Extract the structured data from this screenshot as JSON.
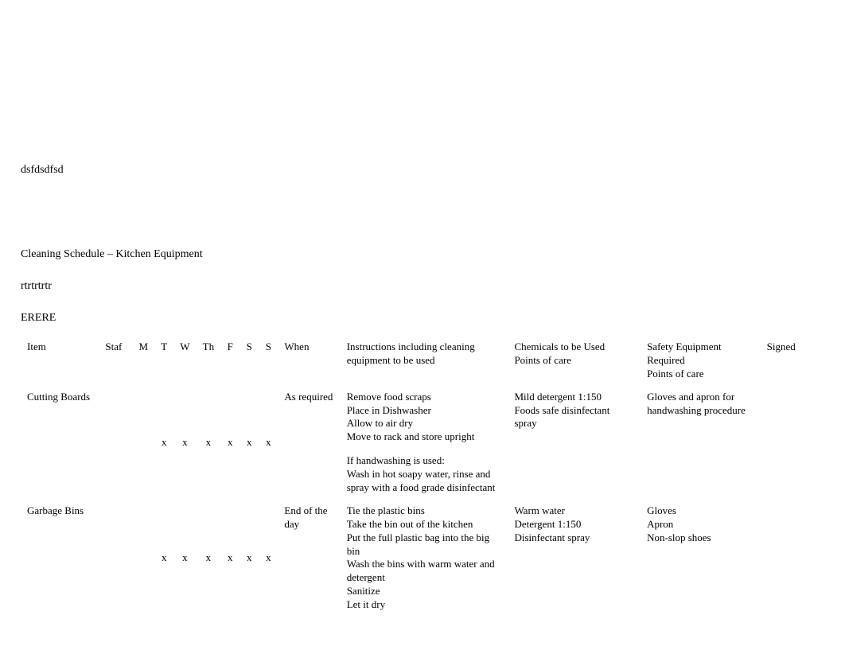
{
  "pre_text_1": "dsfdsdfsd",
  "title": "Cleaning Schedule – Kitchen Equipment",
  "pre_text_2": "rtrtrtrtr",
  "pre_text_3": "ERERE",
  "headers": {
    "item": "Item",
    "staf": "Staf",
    "m": "M",
    "t": "T",
    "w": "W",
    "th": "Th",
    "f": "F",
    "s1": "S",
    "s2": "S",
    "when": "When",
    "instr1": "Instructions including cleaning",
    "instr2": "equipment to be used",
    "chem1": "Chemicals to be Used",
    "chem2": "Points of care",
    "safe1": "Safety Equipment Required",
    "safe2": "Points of care",
    "signed": "Signed"
  },
  "rows": [
    {
      "item": "Cutting Boards",
      "staf": "",
      "m": "",
      "t": "x",
      "w": "x",
      "th": "x",
      "f": "x",
      "s1": "x",
      "s2": "x",
      "when": "As required",
      "instr": [
        "Remove food scraps",
        "Place in Dishwasher",
        "Allow to air dry",
        "Move to rack and store upright",
        "",
        "If handwashing is used:",
        "Wash in hot soapy water, rinse and",
        "spray with a food grade disinfectant"
      ],
      "chem": [
        "Mild detergent 1:150",
        "Foods safe disinfectant spray"
      ],
      "safe": [
        "Gloves and apron for",
        "handwashing procedure"
      ],
      "signed": ""
    },
    {
      "item": "Garbage Bins",
      "staf": "",
      "m": "",
      "t": "x",
      "w": "x",
      "th": "x",
      "f": "x",
      "s1": "x",
      "s2": "x",
      "when": "End of the day",
      "instr": [
        "Tie the plastic bins",
        "Take the bin out of the kitchen",
        "Put the full plastic bag into the big bin",
        "Wash the bins with warm water and",
        "detergent",
        "Sanitize",
        "Let it dry"
      ],
      "chem": [
        "Warm water",
        "Detergent 1:150",
        "Disinfectant spray"
      ],
      "safe": [
        "Gloves",
        "Apron",
        "Non-slop shoes"
      ],
      "signed": ""
    }
  ]
}
